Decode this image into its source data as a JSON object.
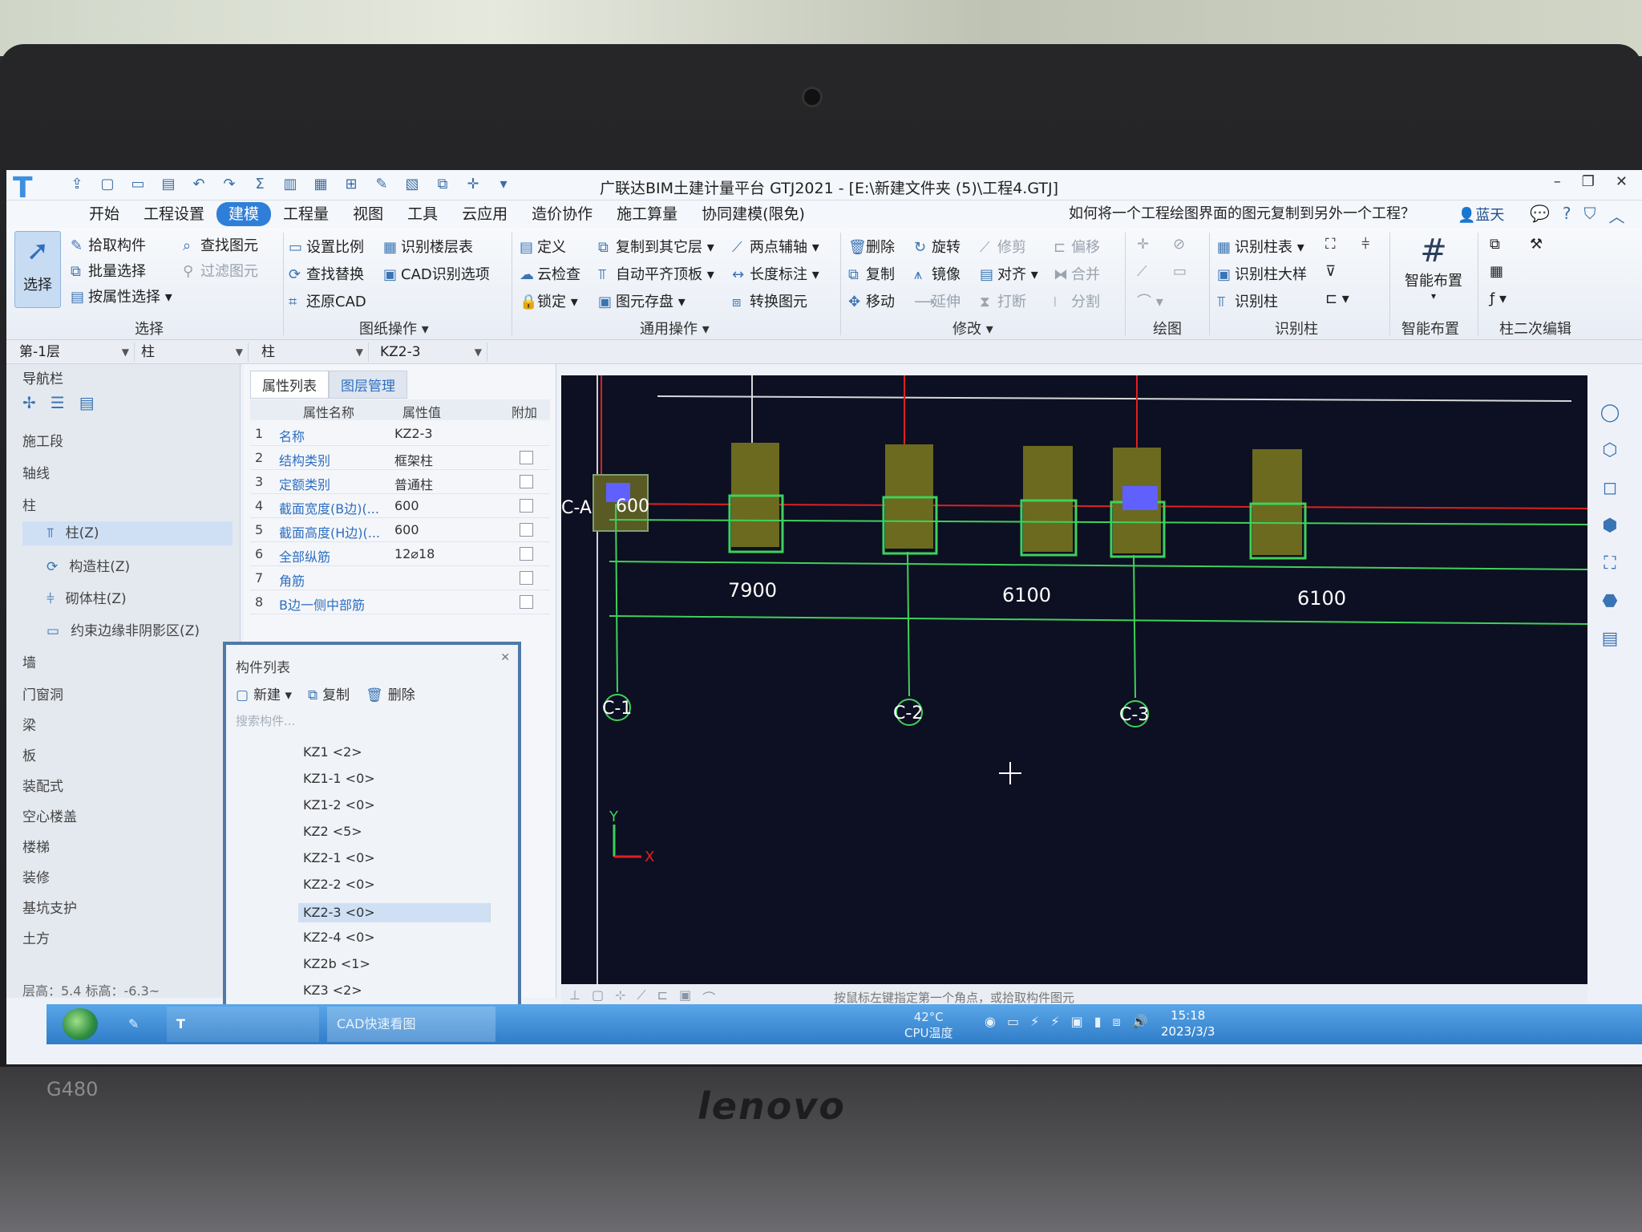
{
  "window": {
    "title": "广联达BIM土建计量平台 GTJ2021 - [E:\\新建文件夹 (5)\\工程4.GTJ]",
    "controls": [
      "–",
      "❐",
      "✕"
    ]
  },
  "tabs": [
    "开始",
    "工程设置",
    "建模",
    "工程量",
    "视图",
    "工具",
    "云应用",
    "造价协作",
    "施工算量",
    "协同建模(限免)"
  ],
  "active_tab": "建模",
  "help_question": "如何将一个工程绘图界面的图元复制到另外一个工程？",
  "user_name": "蓝天",
  "ribbon": {
    "select_label": "选择",
    "select_group": [
      "拾取构件",
      "批量选择",
      "按属性选择"
    ],
    "find_group": [
      "查找图元",
      "过滤图元"
    ],
    "drawing_ops": [
      "设置比例",
      "识别楼层表",
      "查找替换",
      "CAD识别选项",
      "还原CAD"
    ],
    "common_ops": [
      "定义",
      "复制到其它层",
      "两点辅轴",
      "云检查",
      "自动平齐顶板",
      "长度标注",
      "锁定",
      "图元存盘",
      "转换图元"
    ],
    "modify_ops": [
      "删除",
      "旋转",
      "修剪",
      "偏移",
      "复制",
      "镜像",
      "对齐",
      "合并",
      "移动",
      "延伸",
      "打断",
      "分割"
    ],
    "recognize_ops": [
      "识别柱表",
      "识别柱大样",
      "识别柱"
    ],
    "smart_layout": "智能布置",
    "groups": [
      "选择",
      "图纸操作",
      "通用操作",
      "修改",
      "绘图",
      "识别柱",
      "智能布置",
      "柱二次编辑"
    ]
  },
  "selectors": [
    "第-1层",
    "柱",
    "柱",
    "KZ2-3"
  ],
  "nav": {
    "title": "导航栏",
    "items": [
      "施工段",
      "轴线",
      "柱"
    ],
    "sub_items": [
      "柱(Z)",
      "构造柱(Z)",
      "砌体柱(Z)",
      "约束边缘非阴影区(Z)"
    ],
    "more_items": [
      "墙",
      "门窗洞",
      "梁",
      "板",
      "装配式",
      "空心楼盖",
      "楼梯",
      "装修",
      "基坑支护",
      "土方"
    ],
    "footer": "层高：5.4    标高：-6.3~"
  },
  "props": {
    "tabs": [
      "属性列表",
      "图层管理"
    ],
    "headers": [
      "属性名称",
      "属性值",
      "附加"
    ],
    "rows": [
      {
        "n": "1",
        "k": "名称",
        "v": "KZ2-3"
      },
      {
        "n": "2",
        "k": "结构类别",
        "v": "框架柱"
      },
      {
        "n": "3",
        "k": "定额类别",
        "v": "普通柱"
      },
      {
        "n": "4",
        "k": "截面宽度(B边)(...",
        "v": "600"
      },
      {
        "n": "5",
        "k": "截面高度(H边)(...",
        "v": "600"
      },
      {
        "n": "6",
        "k": "全部纵筋",
        "v": "12⌀18"
      },
      {
        "n": "7",
        "k": "角筋",
        "v": ""
      },
      {
        "n": "8",
        "k": "B边一侧中部筋",
        "v": ""
      }
    ]
  },
  "component_list": {
    "title": "构件列表",
    "tools": [
      "新建",
      "复制",
      "删除"
    ],
    "search_placeholder": "搜索构件...",
    "items": [
      "KZ1 <2>",
      "KZ1-1 <0>",
      "KZ1-2 <0>",
      "KZ2 <5>",
      "KZ2-1 <0>",
      "KZ2-2 <0>",
      "KZ2-3 <0>",
      "KZ2-4 <0>",
      "KZ2b <1>",
      "KZ3 <2>"
    ],
    "selected": "KZ2-3 <0>"
  },
  "canvas": {
    "axis_labels": [
      "C-1",
      "C-2",
      "C-3",
      "C-A"
    ],
    "dimensions": [
      "7900",
      "6100",
      "6100"
    ],
    "column_size_label": "600",
    "axis_x": "X",
    "axis_y": "Y"
  },
  "status_message": "按鼠标左键指定第一个角点，或拾取构件图元",
  "taskbar": {
    "apps": [
      "",
      "CAD快速看图"
    ],
    "temp": "42°C",
    "cpu": "CPU温度",
    "time": "15:18",
    "date": "2023/3/3"
  },
  "laptop": {
    "brand": "lenovo",
    "model": "G480"
  },
  "colors": {
    "accent": "#2f7fd8",
    "canvas": "#0d0f22",
    "column": "#6b6a1f",
    "axis": "#3fd15a",
    "redline": "#e02020"
  }
}
